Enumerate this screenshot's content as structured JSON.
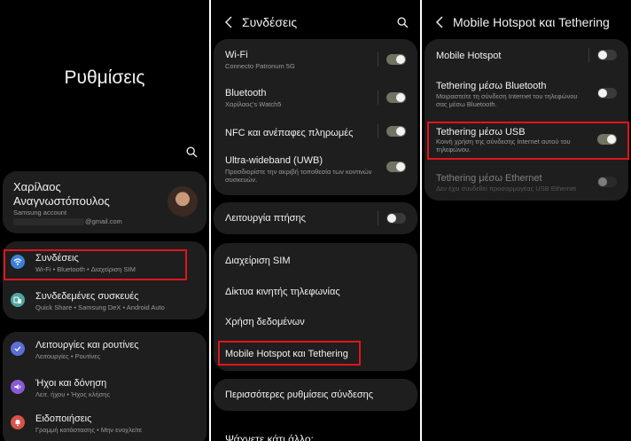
{
  "screen1": {
    "title": "Ρυθμίσεις",
    "profile": {
      "name_line1": "Χαρίλαος",
      "name_line2": "Αναγνωστόπουλος",
      "account_label": "Samsung account",
      "email": "@gmail.com"
    },
    "items": [
      {
        "title": "Συνδέσεις",
        "subtitle": "Wi-Fi • Bluetooth • Διαχείριση SIM"
      },
      {
        "title": "Συνδεδεμένες συσκευές",
        "subtitle": "Quick Share • Samsung DeX • Android Auto"
      },
      {
        "title": "Λειτουργίες και ρουτίνες",
        "subtitle": "Λειτουργίες • Ρουτίνες"
      },
      {
        "title": "Ήχοι και δόνηση",
        "subtitle": "Λειτ. ήχου • Ήχος κλήσης"
      },
      {
        "title": "Ειδοποιήσεις",
        "subtitle": "Γραμμή κατάστασης • Μην ενοχλείτε"
      }
    ]
  },
  "screen2": {
    "title": "Συνδέσεις",
    "items": [
      {
        "title": "Wi-Fi",
        "subtitle": "Connecto Patronum 5G",
        "toggle": true
      },
      {
        "title": "Bluetooth",
        "subtitle": "Χαρίλαος's Watch5",
        "toggle": true
      },
      {
        "title": "NFC και ανέπαφες πληρωμές",
        "toggle": true
      },
      {
        "title": "Ultra-wideband (UWB)",
        "subtitle": "Προσδιορίστε την ακριβή τοποθεσία των κοντινών συσκευών.",
        "toggle": true
      },
      {
        "title": "Λειτουργία πτήσης",
        "toggle": false
      },
      {
        "title": "Διαχείριση SIM"
      },
      {
        "title": "Δίκτυα κινητής τηλεφωνίας"
      },
      {
        "title": "Χρήση δεδομένων"
      },
      {
        "title": "Mobile Hotspot και Tethering"
      },
      {
        "title": "Περισσότερες ρυθμίσεις σύνδεσης"
      }
    ],
    "search_prompt": "Ψάχνετε κάτι άλλο;"
  },
  "screen3": {
    "title": "Mobile Hotspot και Tethering",
    "items": [
      {
        "title": "Mobile Hotspot",
        "toggle": false
      },
      {
        "title": "Tethering μέσω Bluetooth",
        "subtitle": "Μοιραστείτε τη σύνδεση Internet του τηλεφώνου σας μέσω Bluetooth.",
        "toggle": false
      },
      {
        "title": "Tethering μέσω USB",
        "subtitle": "Κοινή χρήση της σύνδεσης Internet αυτού του τηλεφώνου.",
        "toggle": true
      },
      {
        "title": "Tethering μέσω Ethernet",
        "subtitle": "Δεν έχει συνδεθεί προσαρμογέας USB Ethernet",
        "toggle": false,
        "disabled": true
      }
    ]
  },
  "colors": {
    "highlight": "#e0141c",
    "background": "#000000",
    "card": "#1e1e1e",
    "toggle_on": "#6f7562"
  }
}
